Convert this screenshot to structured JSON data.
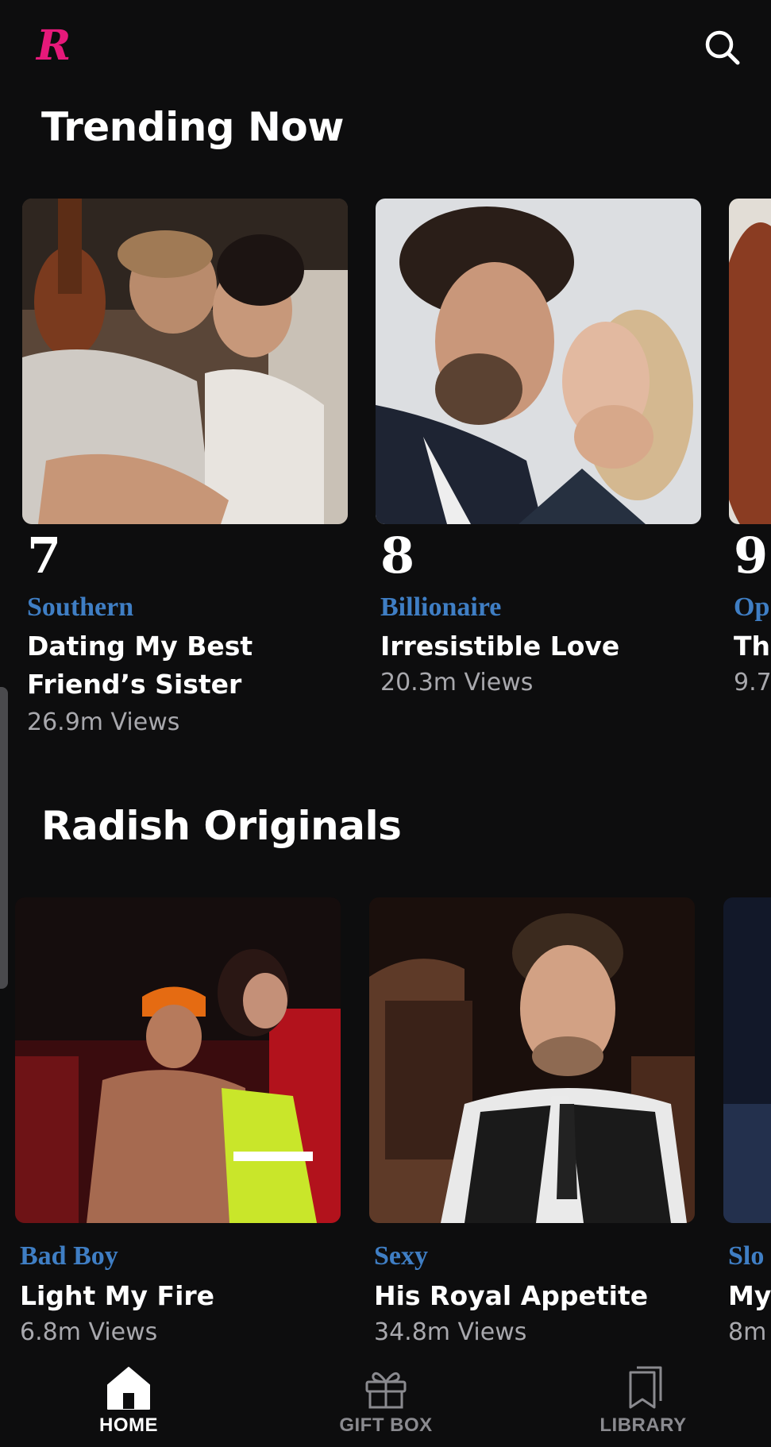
{
  "header": {
    "logo_text": "R",
    "logo_color": "#e6197a",
    "search_icon": "search-icon"
  },
  "sections": {
    "trending": {
      "title": "Trending Now",
      "items": [
        {
          "rank": "7",
          "genre": "Southern",
          "title": "Dating My Best Friend’s Sister",
          "views": "26.9m Views"
        },
        {
          "rank": "8",
          "genre": "Billionaire",
          "title": "Irresistible Love",
          "views": "20.3m Views"
        },
        {
          "rank": "9",
          "genre": "Op",
          "title": "Th",
          "views": "9.7"
        }
      ]
    },
    "originals": {
      "title": "Radish Originals",
      "items": [
        {
          "genre": "Bad Boy",
          "title": "Light My Fire",
          "views": "6.8m Views"
        },
        {
          "genre": "Sexy",
          "title": "His Royal Appetite",
          "views": "34.8m Views"
        },
        {
          "genre": "Slo",
          "title": "My",
          "views": "8m"
        }
      ]
    }
  },
  "bottom_nav": {
    "items": [
      {
        "label": "HOME",
        "icon": "home-icon",
        "active": true
      },
      {
        "label": "GIFT BOX",
        "icon": "gift-icon",
        "active": false
      },
      {
        "label": "LIBRARY",
        "icon": "library-icon",
        "active": false
      }
    ]
  },
  "colors": {
    "background": "#0d0d0e",
    "genre_blue": "#3f7ec4",
    "muted": "#a8a8ad",
    "inactive_nav": "#8a8a8f"
  }
}
